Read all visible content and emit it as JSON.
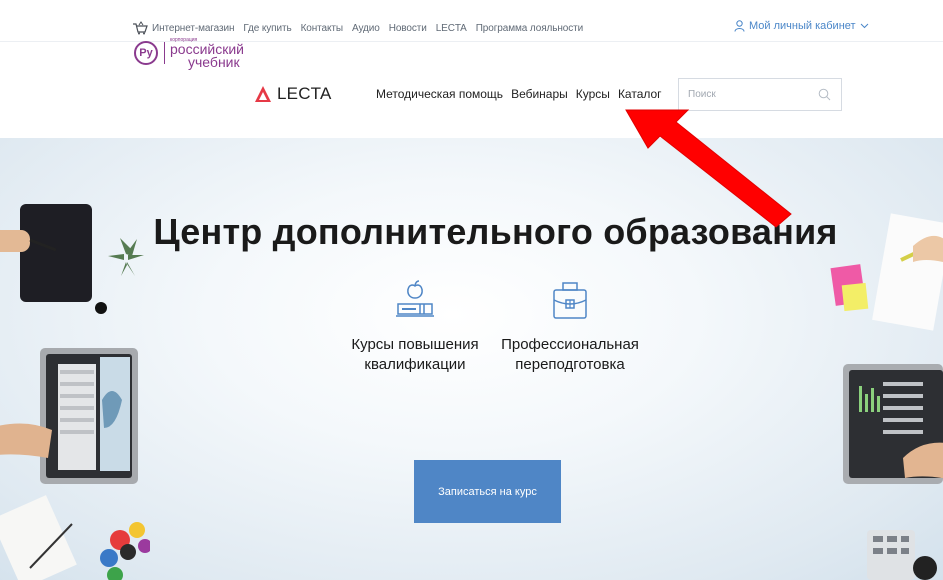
{
  "topbar": {
    "nav": [
      "Интернет-магазин",
      "Где купить",
      "Контакты",
      "Аудио",
      "Новости",
      "LECTA",
      "Программа лояльности"
    ],
    "cabinet_label": "Мой личный кабинет"
  },
  "header": {
    "logo_small": "корпорация",
    "logo_word1": "российский",
    "logo_word2": "учебник",
    "logo_mark": "Ру",
    "lecta_label": "LECTA",
    "nav": [
      "Методическая помощь",
      "Вебинары",
      "Курсы",
      "Каталог"
    ],
    "search_placeholder": "Поиск"
  },
  "hero": {
    "title": "Центр дополнительного образования",
    "card1_title": "Курсы повышения квалификации",
    "card2_title": "Профессиональная переподготовка",
    "button_label": "Записаться на курс"
  },
  "colors": {
    "accent": "#4f86c6",
    "brand_purple": "#8a3a8e",
    "lecta_red": "#e63946",
    "arrow_red": "#ff0000"
  },
  "icons": [
    "cart-icon",
    "user-icon",
    "chevron-down-icon",
    "search-icon",
    "apple-books-icon",
    "briefcase-icon"
  ]
}
